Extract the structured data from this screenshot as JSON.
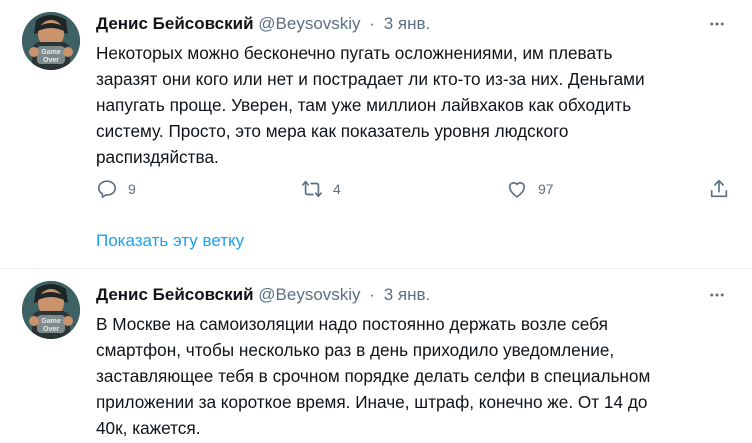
{
  "tweets": [
    {
      "author_name": "Денис Бейсовский",
      "handle": "@Beysovskiy",
      "separator": "·",
      "time": "3 янв.",
      "avatar_text": "Game Over",
      "lines": [
        "Некоторых можно бесконечно пугать осложнениями, им плевать",
        "заразят они кого или нет и пострадает ли кто-то из-за них. Деньгами",
        "напугать проще. Уверен, там уже миллион лайвхаков как обходить",
        "систему. Просто, это мера как показатель уровня людского",
        "распиздяйства."
      ],
      "replies": "9",
      "retweets": "4",
      "likes": "97",
      "show_thread": "Показать эту ветку"
    },
    {
      "author_name": "Денис Бейсовский",
      "handle": "@Beysovskiy",
      "separator": "·",
      "time": "3 янв.",
      "avatar_text": "Game Over",
      "lines": [
        "В Москве на самоизоляции надо постоянно держать возле себя",
        "смартфон, чтобы несколько раз в день приходило уведомление,",
        "заставляющее тебя в срочном порядке делать селфи в специальном",
        "приложении за короткое время. Иначе, штраф, конечно же. От 14 до",
        "40к, кажется."
      ]
    }
  ],
  "colors": {
    "text": "#0f1419",
    "secondary": "#5b7083",
    "link": "#1da1f2",
    "divider": "#ebeef0"
  }
}
